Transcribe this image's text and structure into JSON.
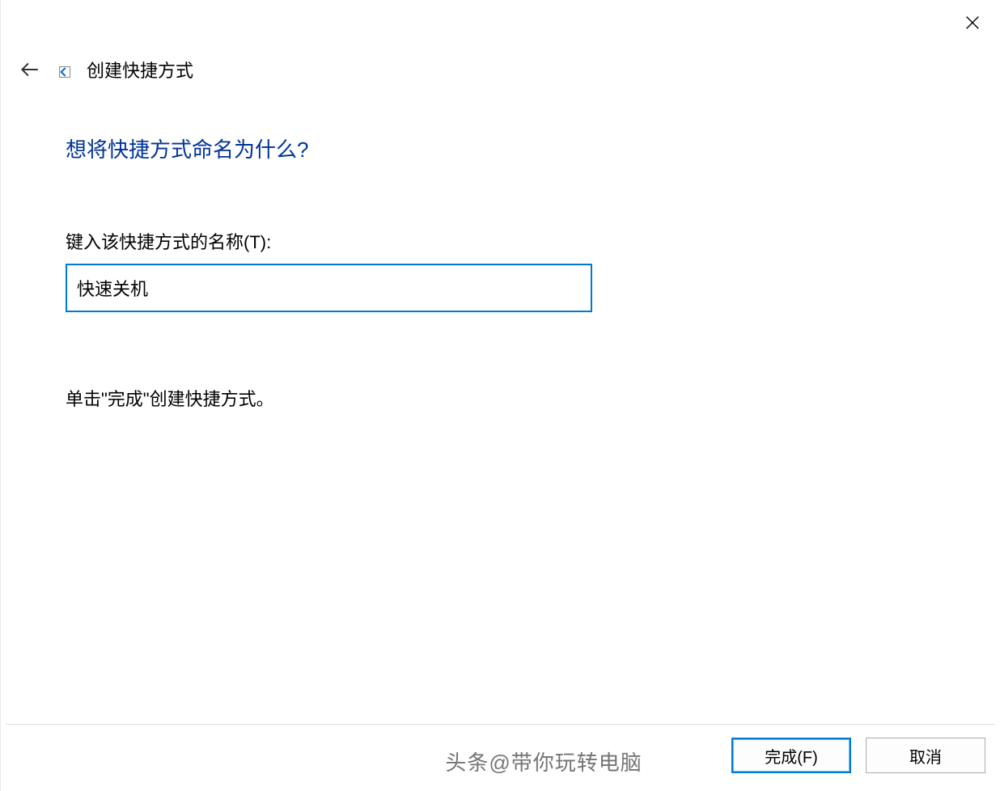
{
  "header": {
    "title": "创建快捷方式"
  },
  "content": {
    "question": "想将快捷方式命名为什么?",
    "name_label": "键入该快捷方式的名称(T):",
    "name_value": "快速关机",
    "instruction": "单击\"完成\"创建快捷方式。"
  },
  "footer": {
    "finish_label": "完成(F)",
    "cancel_label": "取消"
  },
  "watermark": "头条@带你玩转电脑"
}
